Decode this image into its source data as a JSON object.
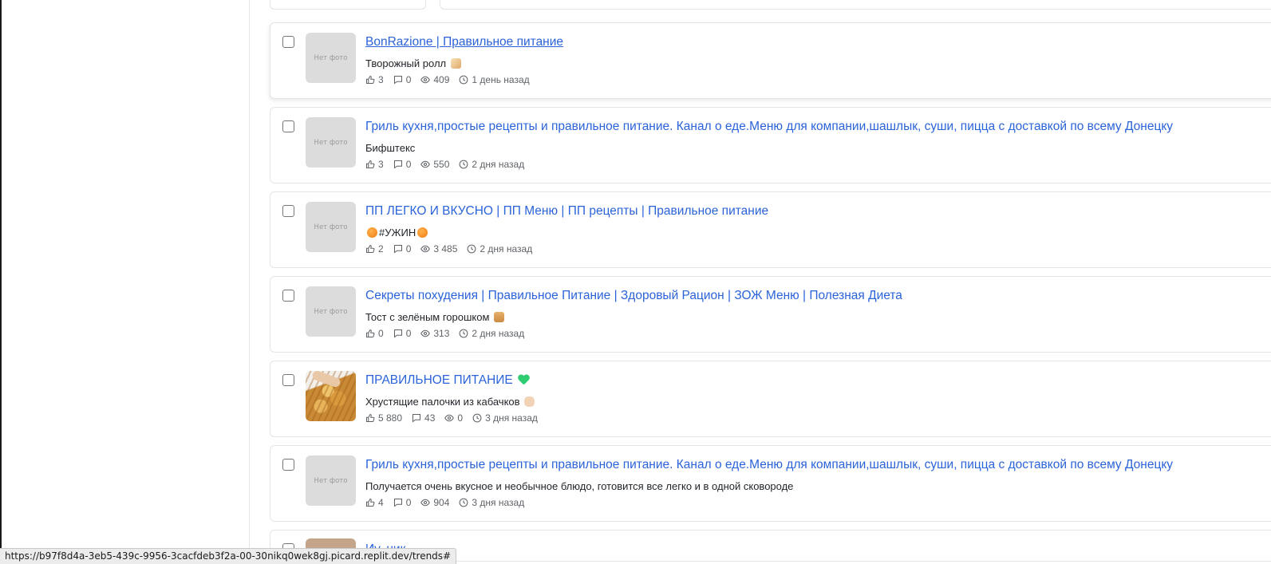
{
  "posts": [
    {
      "channel": "BonRazione | Правильное питание",
      "text": "Творожный ролл",
      "emoji_after": "roll-emoji",
      "likes": "3",
      "comments": "0",
      "views": "409",
      "time": "1 день назад",
      "thumb": "Нет фото",
      "hover": true,
      "underline": true
    },
    {
      "channel": "Гриль кухня,простые рецепты и правильное питание. Канал о еде.Меню для компании,шашлык, суши, пицца с доставкой по всему Донецку",
      "text": "Бифштекс",
      "likes": "3",
      "comments": "0",
      "views": "550",
      "time": "2 дня назад",
      "thumb": "Нет фото"
    },
    {
      "channel": "ПП ЛЕГКО И ВКУСНО | ПП Меню | ПП рецепты | Правильное питание",
      "text": "#УЖИН",
      "emoji_around": "tangerine-emoji",
      "likes": "2",
      "comments": "0",
      "views": "3 485",
      "time": "2 дня назад",
      "thumb": "Нет фото"
    },
    {
      "channel": "Секреты похудения | Правильное Питание | Здоровый Рацион | ЗОЖ Меню | Полезная Диета",
      "text": "Тост с зелёным горошком",
      "emoji_after": "bread-emoji",
      "likes": "0",
      "comments": "0",
      "views": "313",
      "time": "2 дня назад",
      "thumb": "Нет фото"
    },
    {
      "channel": "ПРАВИЛЬНОЕ ПИТАНИЕ",
      "channel_emoji": "green-heart-emoji",
      "text": "Хрустящие палочки из кабачков",
      "emoji_after": "ok-hand-emoji",
      "likes": "5 880",
      "comments": "43",
      "views": "0",
      "time": "3 дня назад",
      "thumb": "photo"
    },
    {
      "channel": "Гриль кухня,простые рецепты и правильное питание. Канал о еде.Меню для компании,шашлык, суши, пицца с доставкой по всему Донецку",
      "text": "Получается очень вкусное и необычное блюдо, готовится все легко и в одной сковороде",
      "likes": "4",
      "comments": "0",
      "views": "904",
      "time": "3 дня назад",
      "thumb": "Нет фото"
    },
    {
      "channel": "Иv..ник",
      "thumb": "photo-partial",
      "partial": true
    }
  ],
  "status_bar": {
    "url": "https://b97f8d4a-3eb5-439c-9956-3cacfdeb3f2a-00-30nikq0wek8gj.picard.replit.dev/trends#"
  },
  "icons": {
    "likes": "thumbs-up-icon",
    "comments": "comment-icon",
    "views": "eye-icon",
    "time": "clock-icon"
  },
  "colors": {
    "link": "#2b63d9",
    "meta": "#5f6368",
    "placeholder_thumb": "#dcdcdc"
  }
}
